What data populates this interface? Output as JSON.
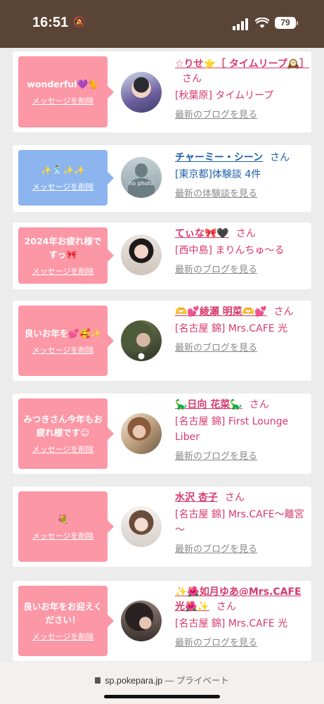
{
  "status_bar": {
    "time": "16:51",
    "battery": "79",
    "bell_icon": "🔕"
  },
  "delete_label": "メッセージを削除",
  "san_label": "さん",
  "cards": [
    {
      "message": "wonderful💜🐈",
      "name": "☆りせ⭐［ タイムリープ🕰️］",
      "store": "[秋葉原] タイムリープ",
      "link": "最新のブログを見る"
    },
    {
      "message": "✨🕺✨✨",
      "name": "チャーミー・シーン",
      "store": "[東京都]体験談 4件",
      "link": "最新の体験談を見る",
      "avatar_text": "no photo"
    },
    {
      "message": "2024年お疲れ様ですっ🎀",
      "name": "てぃな🎀🖤",
      "store": "[西中島] まりんちゅ～る",
      "link": "最新のブログを見る"
    },
    {
      "message": "良いお年を💕🥰✨",
      "name": "🫶💕綾瀬 明菜🫶💕",
      "store": "[名古屋 錦] Mrs.CAFE 光",
      "link": "最新のブログを見る"
    },
    {
      "message": "みつきさん今年もお疲れ様です☺",
      "name": "🦕日向 花菜🦕",
      "store": "[名古屋 錦] First Lounge Liber",
      "link": "最新のブログを見る"
    },
    {
      "message": "💐",
      "name": "水沢 杏子",
      "store": "[名古屋 錦] Mrs.CAFE～離宮～",
      "link": "最新のブログを見る"
    },
    {
      "message": "良いお年をお迎えください！",
      "name": "✨🌺如月ゆあ@Mrs.CAFE光🌺✨",
      "store": "[名古屋 錦] Mrs.CAFE 光",
      "link": "最新のブログを見る"
    }
  ],
  "browser": {
    "domain": "sp.pokepara.jp",
    "mode": "— プライベート"
  }
}
